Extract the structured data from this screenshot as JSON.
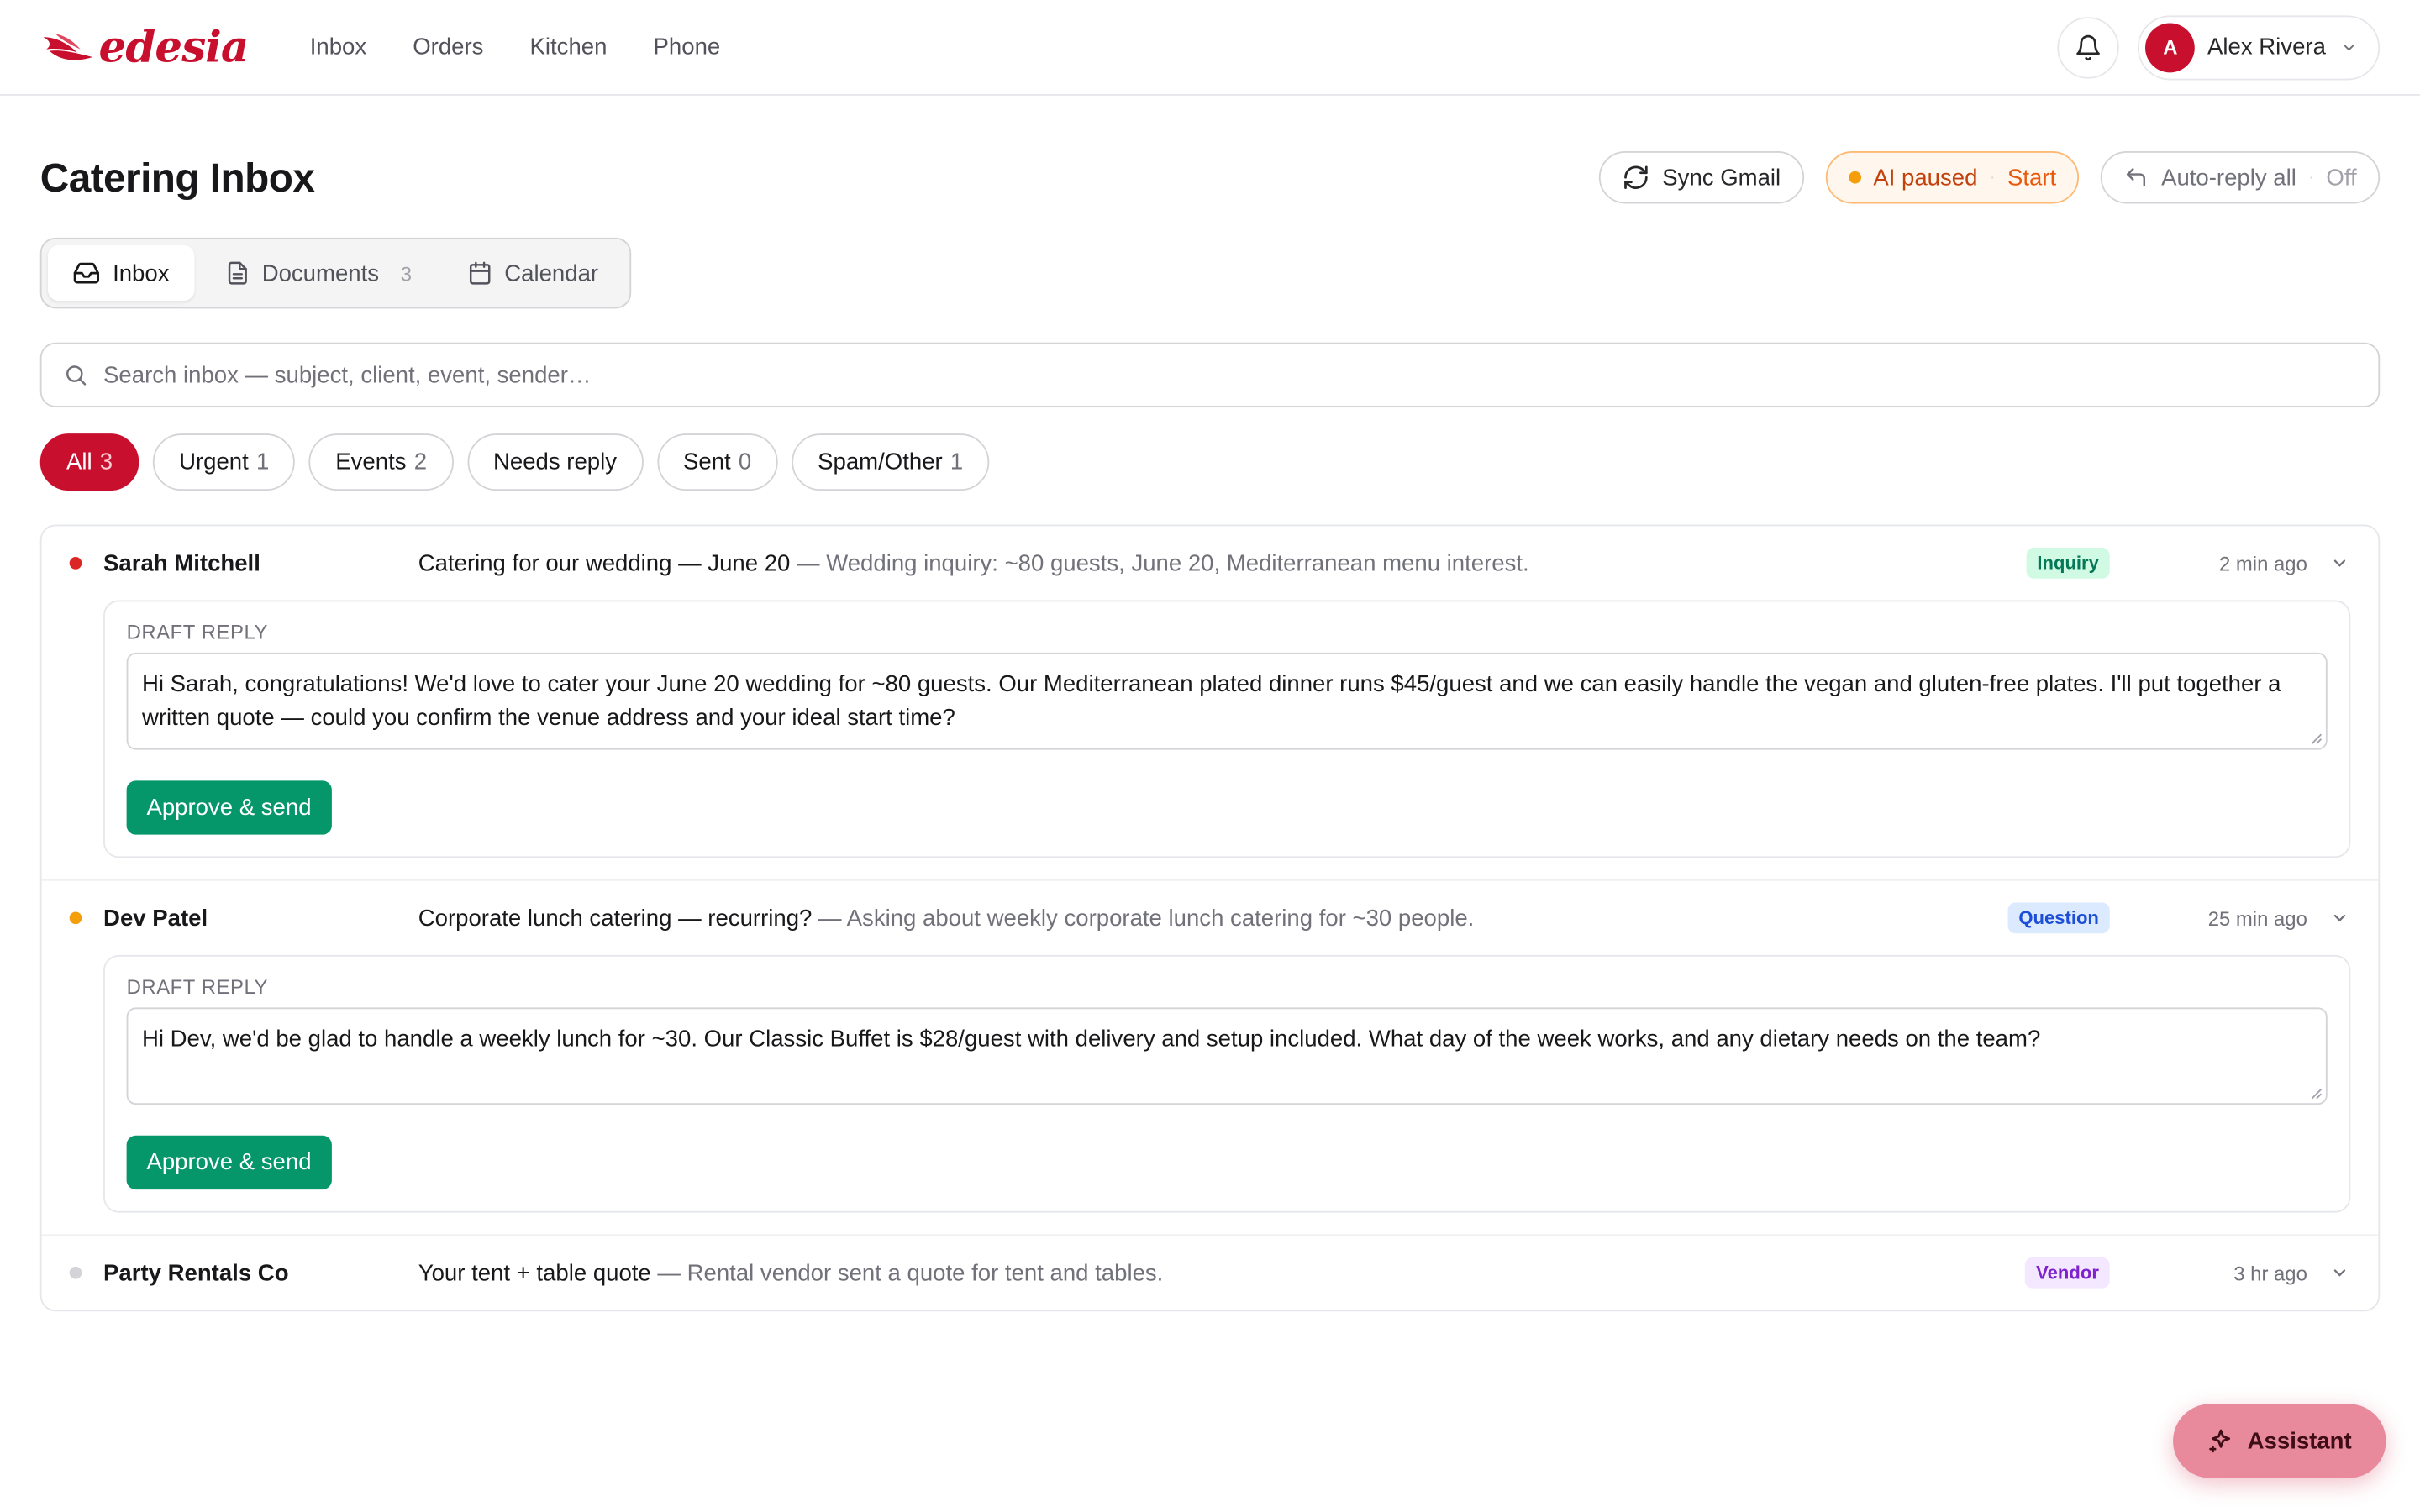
{
  "brand": {
    "name": "edesia",
    "color": "#c8102e"
  },
  "nav": [
    "Inbox",
    "Orders",
    "Kitchen",
    "Phone"
  ],
  "user": {
    "initial": "A",
    "name": "Alex Rivera"
  },
  "page": {
    "title": "Catering Inbox"
  },
  "actions": {
    "sync": "Sync Gmail",
    "ai_status": "AI paused",
    "ai_action": "Start",
    "autoreply": "Auto-reply all",
    "autoreply_state": "Off"
  },
  "tabs": [
    {
      "label": "Inbox",
      "count": ""
    },
    {
      "label": "Documents",
      "count": "3"
    },
    {
      "label": "Calendar",
      "count": ""
    }
  ],
  "search": {
    "placeholder": "Search inbox — subject, client, event, sender…"
  },
  "filters": [
    {
      "label": "All",
      "count": "3"
    },
    {
      "label": "Urgent",
      "count": "1"
    },
    {
      "label": "Events",
      "count": "2"
    },
    {
      "label": "Needs reply",
      "count": ""
    },
    {
      "label": "Sent",
      "count": "0"
    },
    {
      "label": "Spam/Other",
      "count": "1"
    }
  ],
  "messages": [
    {
      "sender": "Sarah Mitchell",
      "subject": "Catering for our wedding — June 20",
      "snippet": " — Wedding inquiry: ~80 guests, June 20, Mediterranean menu interest.",
      "badge": "Inquiry",
      "time": "2 min ago",
      "dot_color": "#dc2626",
      "draft_label": "DRAFT REPLY",
      "draft": "Hi Sarah, congratulations! We'd love to cater your June 20 wedding for ~80 guests. Our Mediterranean plated dinner runs $45/guest and we can easily handle the vegan and gluten-free plates. I'll put together a written quote — could you confirm the venue address and your ideal start time?",
      "approve": "Approve & send"
    },
    {
      "sender": "Dev Patel",
      "subject": "Corporate lunch catering — recurring?",
      "snippet": " — Asking about weekly corporate lunch catering for ~30 people.",
      "badge": "Question",
      "time": "25 min ago",
      "dot_color": "#f59e0b",
      "draft_label": "DRAFT REPLY",
      "draft": "Hi Dev, we'd be glad to handle a weekly lunch for ~30. Our Classic Buffet is $28/guest with delivery and setup included. What day of the week works, and any dietary needs on the team?",
      "approve": "Approve & send"
    },
    {
      "sender": "Party Rentals Co",
      "subject": "Your tent + table quote",
      "snippet": " — Rental vendor sent a quote for tent and tables.",
      "badge": "Vendor",
      "time": "3 hr ago",
      "dot_color": "#d4d4d8"
    }
  ],
  "assistant": {
    "label": "Assistant"
  }
}
